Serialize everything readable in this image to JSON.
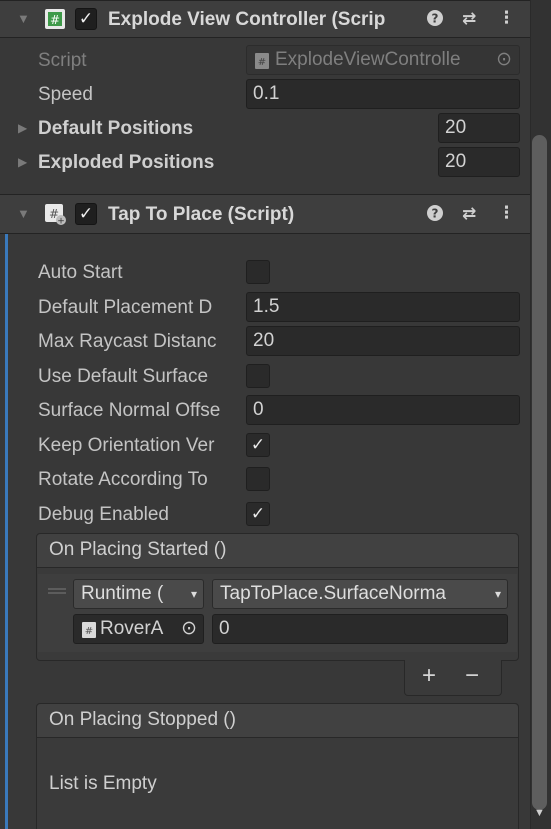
{
  "explode_view": {
    "title": "Explode View Controller (Scrip",
    "enabled": "✓",
    "script_label": "Script",
    "script_value": "ExplodeViewControlle",
    "speed_label": "Speed",
    "speed_value": "0.1",
    "default_positions_label": "Default Positions",
    "default_positions_value": "20",
    "exploded_positions_label": "Exploded Positions",
    "exploded_positions_value": "20"
  },
  "tap_to_place": {
    "title": "Tap To Place (Script)",
    "enabled": "✓",
    "fields": {
      "auto_start": {
        "label": "Auto Start",
        "checked": ""
      },
      "default_placement": {
        "label": "Default Placement D",
        "value": "1.5"
      },
      "max_raycast": {
        "label": "Max Raycast Distanc",
        "value": "20"
      },
      "use_default_surface": {
        "label": "Use Default Surface",
        "checked": ""
      },
      "surface_normal_offset": {
        "label": "Surface Normal Offse",
        "value": "0"
      },
      "keep_orientation": {
        "label": "Keep Orientation Ver",
        "checked": "✓"
      },
      "rotate_according": {
        "label": "Rotate According To",
        "checked": ""
      },
      "debug_enabled": {
        "label": "Debug Enabled",
        "checked": "✓"
      }
    },
    "on_placing_started": {
      "title": "On Placing Started ()",
      "runtime_mode": "Runtime (",
      "function": "TapToPlace.SurfaceNorma",
      "target_object": "RoverA",
      "argument": "0",
      "add": "+",
      "remove": "−"
    },
    "on_placing_stopped": {
      "title": "On Placing Stopped ()",
      "empty_text": "List is Empty"
    }
  },
  "icons": {
    "help": "?",
    "settings": "⇄",
    "menu": "⋮",
    "fold_open": "▼",
    "fold_closed": "▶",
    "dropdown": "▾",
    "object_picker": "⊙",
    "scroll_down": "▼"
  },
  "colors": {
    "selection_accent": "#3a79bb",
    "script_icon_green": "#3f9a4a"
  }
}
